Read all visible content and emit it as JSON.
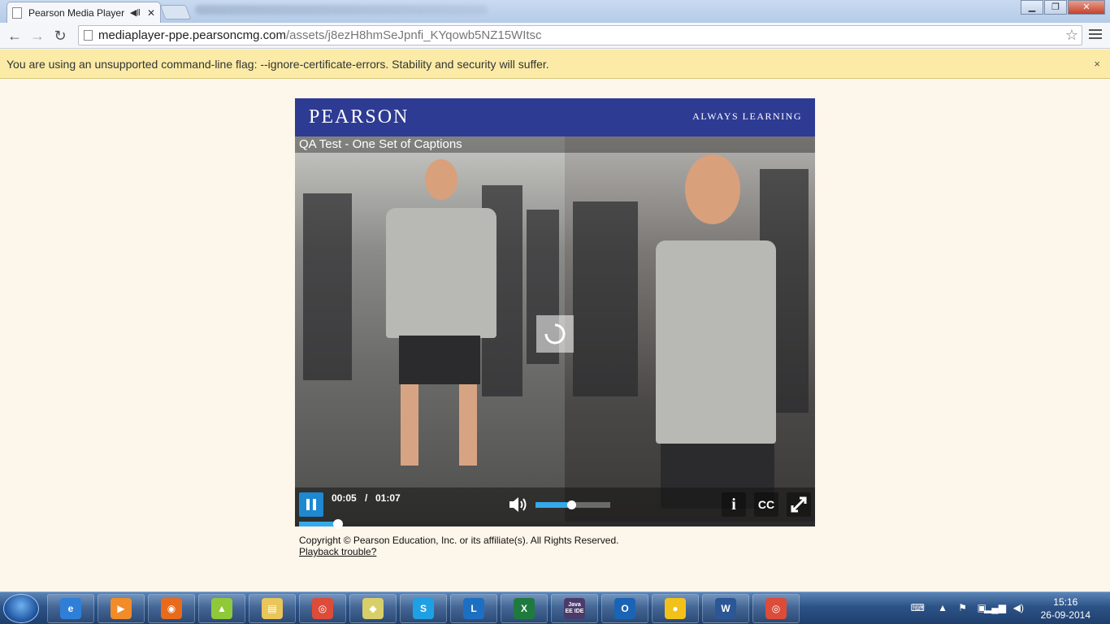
{
  "browser": {
    "tab_title": "Pearson Media Player",
    "tab_close": "✕",
    "url_host": "mediaplayer-ppe.pearsoncmg.com",
    "url_path": "/assets/j8ezH8hmSeJpnfi_KYqowb5NZ15WItsc",
    "window_buttons": [
      "▁",
      "❐",
      "✕"
    ]
  },
  "infobar": {
    "message": "You are using an unsupported command-line flag: --ignore-certificate-errors. Stability and security will suffer.",
    "close": "×"
  },
  "player": {
    "brand": "PEARSON",
    "tagline": "ALWAYS LEARNING",
    "video_title": "QA Test - One Set of Captions",
    "current_time": "00:05",
    "separator": "/",
    "duration": "01:07",
    "cc_label": "CC",
    "info_label": "i",
    "volume_fraction": 0.48,
    "progress_fraction": 0.075
  },
  "footer": {
    "copyright": "Copyright © Pearson Education, Inc. or its affiliate(s). All Rights Reserved.",
    "playback_link": "Playback trouble?"
  },
  "taskbar": {
    "apps": [
      {
        "name": "ie",
        "label": "e",
        "color": "#2f7fd8"
      },
      {
        "name": "media-player",
        "label": "▶",
        "color": "#f28c28"
      },
      {
        "name": "firefox",
        "label": "◉",
        "color": "#e86a1c"
      },
      {
        "name": "android",
        "label": "▲",
        "color": "#8fc93a"
      },
      {
        "name": "file-explorer",
        "label": "▤",
        "color": "#e9c65a"
      },
      {
        "name": "chrome",
        "label": "◎",
        "color": "#dd4b39"
      },
      {
        "name": "notes",
        "label": "◆",
        "color": "#d8cf6a"
      },
      {
        "name": "skype",
        "label": "S",
        "color": "#1fa0e3"
      },
      {
        "name": "lync",
        "label": "L",
        "color": "#1d6fc2"
      },
      {
        "name": "excel",
        "label": "X",
        "color": "#1f7a3e"
      },
      {
        "name": "java-ee-ide",
        "label": "Java EE IDE",
        "color": "#4a3b6b"
      },
      {
        "name": "outlook",
        "label": "O",
        "color": "#1a64b5"
      },
      {
        "name": "duck",
        "label": "●",
        "color": "#f3c21a"
      },
      {
        "name": "word",
        "label": "W",
        "color": "#2b5797"
      },
      {
        "name": "chrome-active",
        "label": "◎",
        "color": "#dd4b39"
      }
    ],
    "time": "15:16",
    "date": "26-09-2014"
  }
}
